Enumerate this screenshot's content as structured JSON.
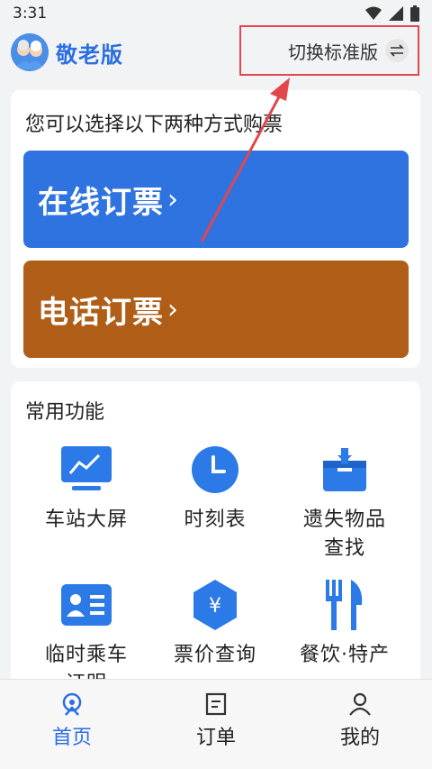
{
  "status_bar": {
    "time": "3:31"
  },
  "header": {
    "app_title": "敬老版",
    "switch_label": "切换标准版"
  },
  "ticket_card": {
    "title": "您可以选择以下两种方式购票",
    "online_label": "在线订票",
    "phone_label": "电话订票",
    "chevron": "›"
  },
  "functions": {
    "title": "常用功能",
    "items": [
      {
        "label": "车站大屏",
        "icon": "monitor-chart-icon"
      },
      {
        "label": "时刻表",
        "icon": "clock-icon"
      },
      {
        "label": "遗失物品\n查找",
        "icon": "lost-box-icon"
      },
      {
        "label": "临时乘车\n证明",
        "icon": "id-card-icon"
      },
      {
        "label": "票价查询",
        "icon": "yuan-hexagon-icon"
      },
      {
        "label": "餐饮·特产",
        "icon": "fork-knife-icon"
      }
    ]
  },
  "tabbar": {
    "tabs": [
      {
        "label": "首页",
        "icon": "home-train-icon",
        "active": true
      },
      {
        "label": "订单",
        "icon": "order-list-icon",
        "active": false
      },
      {
        "label": "我的",
        "icon": "profile-icon",
        "active": false
      }
    ]
  },
  "colors": {
    "accent": "#2b6fe0",
    "online_button": "#2f73e0",
    "phone_button": "#b05e17",
    "highlight": "#e2474d"
  }
}
